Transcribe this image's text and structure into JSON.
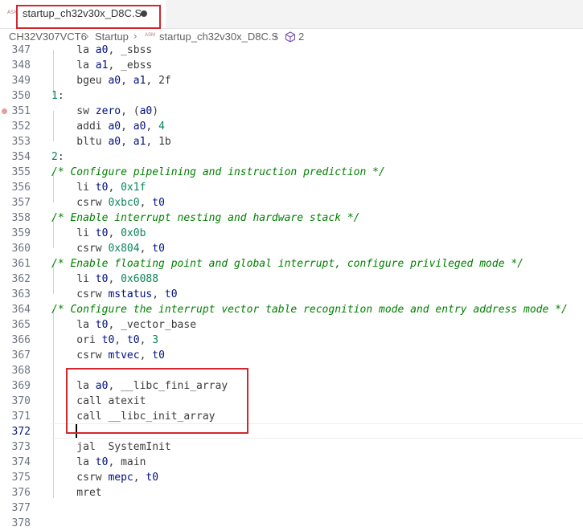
{
  "tab": {
    "icon_text": "ASM",
    "label": "startup_ch32v30x_D8C.S",
    "dirty": true
  },
  "breadcrumb": {
    "items": [
      "CH32V307VCT6",
      "Startup",
      "startup_ch32v30x_D8C.S"
    ],
    "file_icon_text": "ASM",
    "symbol_label": "2"
  },
  "editor": {
    "active_line": 372,
    "breakpoint_line": 351,
    "lines": [
      {
        "n": "347",
        "t": "    la a0, _sbss"
      },
      {
        "n": "348",
        "t": "    la a1, _ebss"
      },
      {
        "n": "349",
        "t": "    bgeu a0, a1, 2f"
      },
      {
        "n": "350",
        "t": "1:"
      },
      {
        "n": "351",
        "t": "    sw zero, (a0)"
      },
      {
        "n": "352",
        "t": "    addi a0, a0, 4"
      },
      {
        "n": "353",
        "t": "    bltu a0, a1, 1b"
      },
      {
        "n": "354",
        "t": "2:"
      },
      {
        "n": "355",
        "t": "/* Configure pipelining and instruction prediction */"
      },
      {
        "n": "356",
        "t": "    li t0, 0x1f"
      },
      {
        "n": "357",
        "t": "    csrw 0xbc0, t0"
      },
      {
        "n": "358",
        "t": "/* Enable interrupt nesting and hardware stack */"
      },
      {
        "n": "359",
        "t": "    li t0, 0x0b"
      },
      {
        "n": "360",
        "t": "    csrw 0x804, t0"
      },
      {
        "n": "361",
        "t": "/* Enable floating point and global interrupt, configure privileged mode */"
      },
      {
        "n": "362",
        "t": "    li t0, 0x6088"
      },
      {
        "n": "363",
        "t": "    csrw mstatus, t0"
      },
      {
        "n": "364",
        "t": "/* Configure the interrupt vector table recognition mode and entry address mode */"
      },
      {
        "n": "365",
        "t": "    la t0, _vector_base"
      },
      {
        "n": "366",
        "t": "    ori t0, t0, 3"
      },
      {
        "n": "367",
        "t": "    csrw mtvec, t0"
      },
      {
        "n": "368",
        "t": ""
      },
      {
        "n": "369",
        "t": "    la a0, __libc_fini_array"
      },
      {
        "n": "370",
        "t": "    call atexit"
      },
      {
        "n": "371",
        "t": "    call __libc_init_array"
      },
      {
        "n": "372",
        "t": ""
      },
      {
        "n": "373",
        "t": "    jal  SystemInit"
      },
      {
        "n": "374",
        "t": "    la t0, main"
      },
      {
        "n": "375",
        "t": "    csrw mepc, t0"
      },
      {
        "n": "376",
        "t": "    mret"
      },
      {
        "n": "377",
        "t": ""
      },
      {
        "n": "378",
        "t": ""
      }
    ]
  },
  "colors": {
    "highlight_box": "#d0282e",
    "comment": "#008000",
    "number": "#098658",
    "register": "#001080",
    "line_number": "#6e7681",
    "breakpoint": "#e89b9b"
  }
}
